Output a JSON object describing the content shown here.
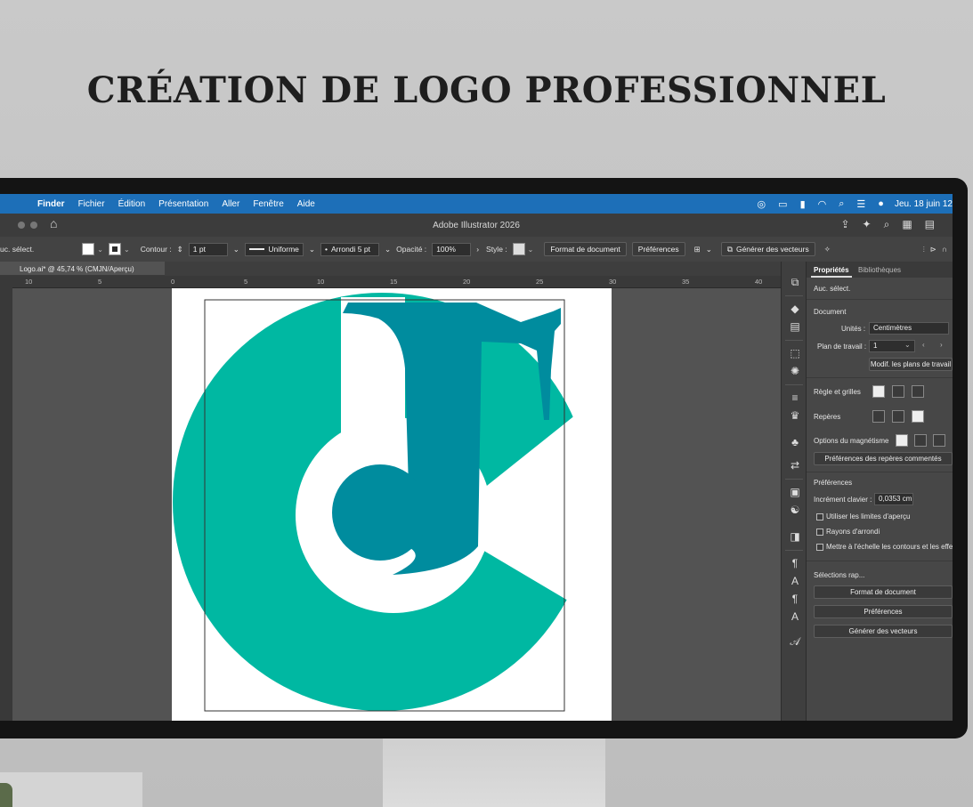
{
  "headline": "CRÉATION DE LOGO PROFESSIONNEL",
  "menubar": {
    "items": [
      "Finder",
      "Fichier",
      "Édition",
      "Présentation",
      "Aller",
      "Fenêtre",
      "Aide"
    ],
    "clock": "Jeu. 18 juin 12"
  },
  "app": {
    "title": "Adobe Illustrator 2026"
  },
  "controlbar": {
    "selection": "uc. sélect.",
    "stroke_label": "Contour :",
    "stroke_weight": "1 pt",
    "profile": "Uniforme",
    "brush": "Arrondi 5 pt",
    "opacity_label": "Opacité :",
    "opacity_value": "100%",
    "style_label": "Style :",
    "document_format": "Format de document",
    "preferences": "Préférences",
    "generate_vectors": "Générer des vecteurs"
  },
  "document_tab": {
    "label": "Logo.ai* @ 45,74 % (CMJN/Aperçu)"
  },
  "ruler": {
    "ticks": [
      "10",
      "5",
      "0",
      "5",
      "10",
      "15",
      "20",
      "25",
      "30",
      "35",
      "40"
    ]
  },
  "logo": {
    "colors": {
      "teal_light": "#00b8a2",
      "teal_dark": "#008c9e"
    }
  },
  "panel": {
    "tab_properties": "Propriétés",
    "tab_libraries": "Bibliothèques",
    "no_selection": "Auc. sélect.",
    "document_section": "Document",
    "units_label": "Unités :",
    "units_value": "Centimètres",
    "artboard_label": "Plan de travail :",
    "artboard_value": "1",
    "edit_artboards": "Modif. les plans de travail",
    "rulers_grids": "Règle et grilles",
    "guides": "Repères",
    "snap_options": "Options du magnétisme",
    "comment_guides_prefs": "Préférences des repères commentés",
    "preferences_section": "Préférences",
    "keyboard_increment_label": "Incrément clavier :",
    "keyboard_increment_value": "0,0353 cm",
    "use_preview_bounds": "Utiliser les limites d'aperçu",
    "round_corners": "Rayons d'arrondi",
    "scale_strokes": "Mettre à l'échelle les contours et les effets",
    "quick_actions": "Sélections rap...",
    "document_format_btn": "Format de document",
    "preferences_btn": "Préférences",
    "generate_vectors_btn": "Générer des vecteurs"
  },
  "colors": {
    "menubar": "#1d6fb8",
    "workspace": "#535353",
    "panel": "#474747"
  }
}
